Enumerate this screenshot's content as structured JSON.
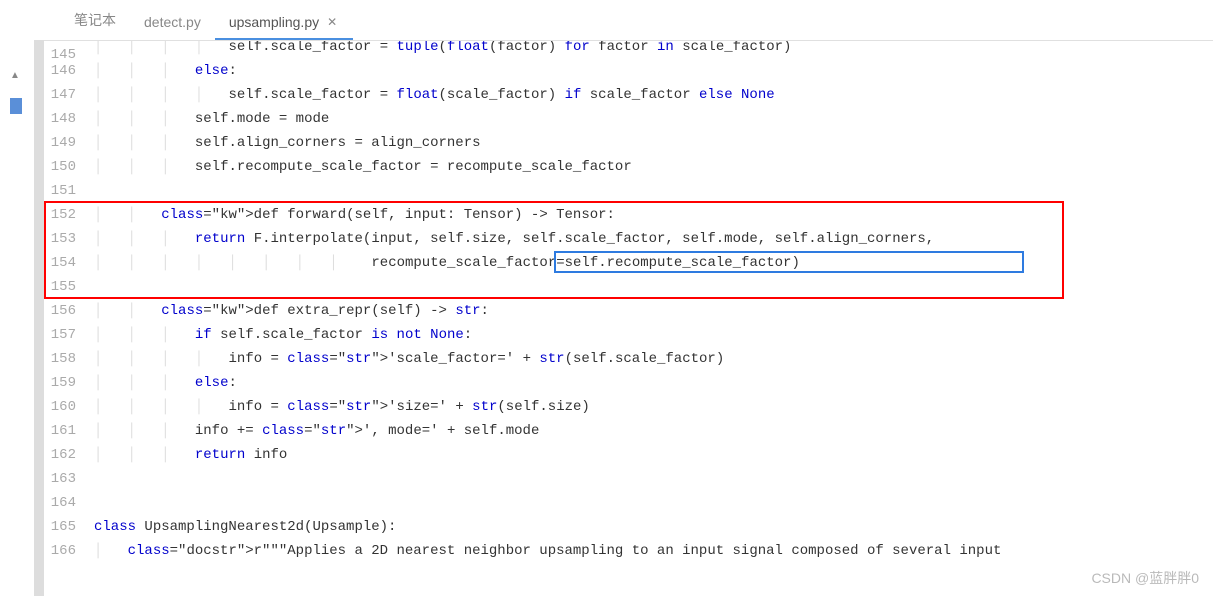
{
  "tabs": [
    {
      "label": "笔记本"
    },
    {
      "label": "detect.py"
    },
    {
      "label": "upsampling.py",
      "active": true
    }
  ],
  "close_glyph": "✕",
  "lines": [
    {
      "n": "145",
      "html": "                self.scale_factor = tuple(float(factor) for factor in scale_factor)",
      "partial": true
    },
    {
      "n": "146",
      "html": "            else:"
    },
    {
      "n": "147",
      "html": "                self.scale_factor = float(scale_factor) if scale_factor else None"
    },
    {
      "n": "148",
      "html": "            self.mode = mode"
    },
    {
      "n": "149",
      "html": "            self.align_corners = align_corners"
    },
    {
      "n": "150",
      "html": "            self.recompute_scale_factor = recompute_scale_factor"
    },
    {
      "n": "151",
      "html": ""
    },
    {
      "n": "152",
      "html": "        def forward(self, input: Tensor) -> Tensor:"
    },
    {
      "n": "153",
      "html": "            return F.interpolate(input, self.size, self.scale_factor, self.mode, self.align_corners,"
    },
    {
      "n": "154",
      "html": "                                 recompute_scale_factor=self.recompute_scale_factor)"
    },
    {
      "n": "155",
      "html": ""
    },
    {
      "n": "156",
      "html": "        def extra_repr(self) -> str:"
    },
    {
      "n": "157",
      "html": "            if self.scale_factor is not None:"
    },
    {
      "n": "158",
      "html": "                info = 'scale_factor=' + str(self.scale_factor)"
    },
    {
      "n": "159",
      "html": "            else:"
    },
    {
      "n": "160",
      "html": "                info = 'size=' + str(self.size)"
    },
    {
      "n": "161",
      "html": "            info += ', mode=' + self.mode"
    },
    {
      "n": "162",
      "html": "            return info"
    },
    {
      "n": "163",
      "html": ""
    },
    {
      "n": "164",
      "html": ""
    },
    {
      "n": "165",
      "html": "class UpsamplingNearest2d(Upsample):"
    },
    {
      "n": "166",
      "html": "    r\"\"\"Applies a 2D nearest neighbor upsampling to an input signal composed of several input"
    }
  ],
  "highlight": {
    "red_box_lines": [
      152,
      155
    ],
    "blue_box_line": 154,
    "blue_box_text": "recompute_scale_factor=self.recompute_scale_factor)"
  },
  "watermark": "CSDN @蓝胖胖0"
}
